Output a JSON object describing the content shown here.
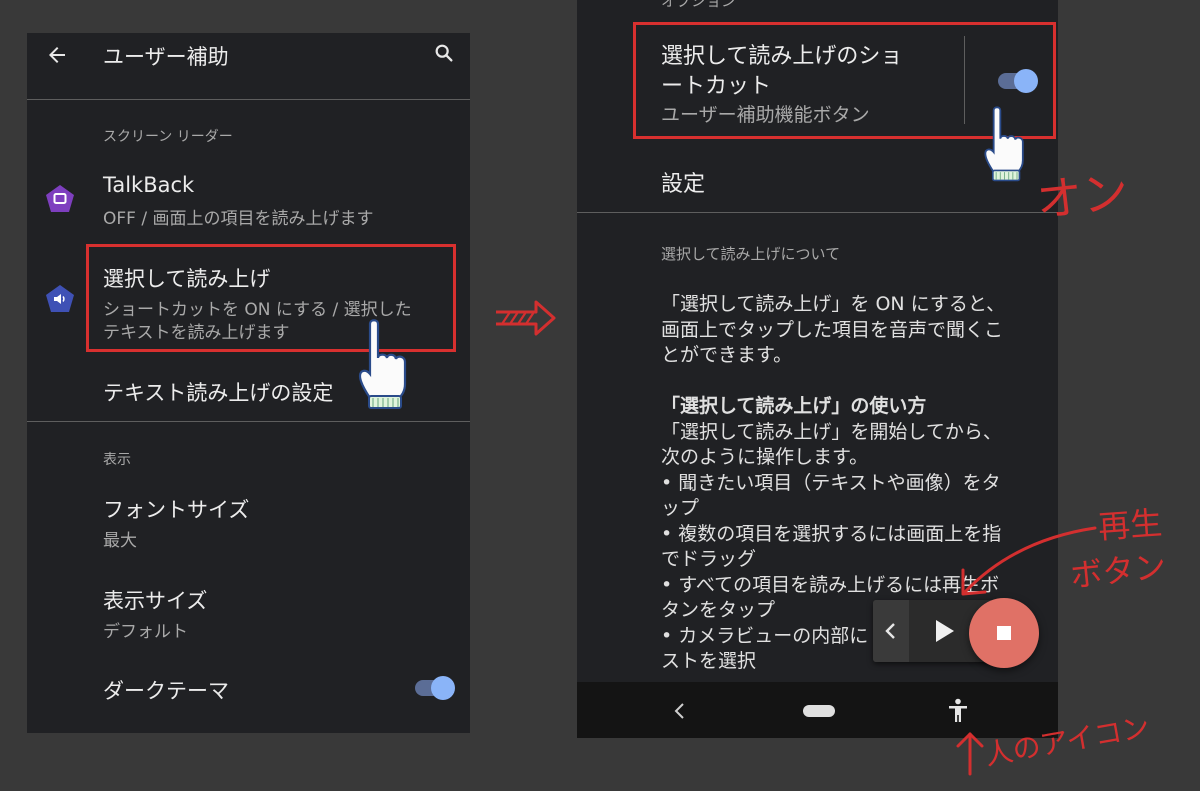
{
  "left_screen": {
    "header_title": "ユーザー補助",
    "section_screen_reader": "スクリーン リーダー",
    "talkback_title": "TalkBack",
    "talkback_sub": "OFF / 画面上の項目を読み上げます",
    "select_to_speak_title": "選択して読み上げ",
    "select_to_speak_sub_1": "ショートカットを ON にする / 選択した",
    "select_to_speak_sub_2": "テキストを読み上げます",
    "tts_settings": "テキスト読み上げの設定",
    "section_display": "表示",
    "font_size_title": "フォントサイズ",
    "font_size_value": "最大",
    "display_size_title": "表示サイズ",
    "display_size_value": "デフォルト",
    "dark_theme_title": "ダークテーマ",
    "dark_theme_on": true
  },
  "right_screen": {
    "top_cut_label": "オプション",
    "shortcut_title_1": "選択して読み上げのショ",
    "shortcut_title_2": "ートカット",
    "shortcut_sub": "ユーザー補助機能ボタン",
    "shortcut_on": true,
    "settings_label": "設定",
    "about_heading": "選択して読み上げについて",
    "desc": [
      "「選択して読み上げ」を ON にすると、",
      "画面上でタップした項目を音声で聞くこ",
      "とができます。"
    ],
    "howto_heading": "「選択して読み上げ」の使い方",
    "howto": [
      "「選択して読み上げ」を開始してから、",
      "次のように操作します。",
      "• 聞きたい項目（テキストや画像）をタ",
      "ップ",
      "• 複数の項目を選択するには画面上を指",
      "でドラッグ",
      "• すべての項目を読み上げるには再生ボ",
      "タンをタップ",
      "• カメラビューの内部に",
      "ストを選択"
    ]
  },
  "annotations": {
    "on_label": "オン",
    "play_button_label_1": "再生",
    "play_button_label_2": "ボタン",
    "person_icon_label": "人のアイコン"
  },
  "colors": {
    "accent": "#8ab4f8",
    "highlight_red": "#d8302f",
    "stop_button": "#e07166",
    "talkback_icon": "#7e3fbf",
    "select_icon": "#3f51b5"
  }
}
